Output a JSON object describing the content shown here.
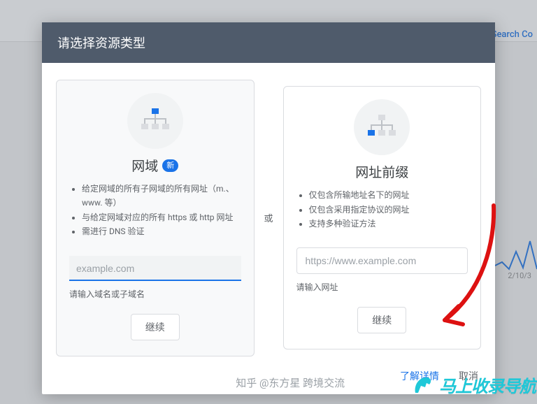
{
  "background": {
    "link_text": "Search Co",
    "chart_date": "2/10/3"
  },
  "modal": {
    "title": "请选择资源类型",
    "or_label": "或",
    "footer": {
      "learn_more": "了解详情",
      "cancel": "取消"
    },
    "domain_card": {
      "title": "网域",
      "new_badge": "新",
      "bullets": [
        "给定网域的所有子网域的所有网址（m.、www. 等）",
        "与给定网域对应的所有 https 或 http 网址",
        "需进行 DNS 验证"
      ],
      "placeholder": "example.com",
      "helper": "请输入域名或子域名",
      "continue_label": "继续"
    },
    "url_card": {
      "title": "网址前缀",
      "bullets": [
        "仅包含所输地址名下的网址",
        "仅包含采用指定协议的网址",
        "支持多种验证方法"
      ],
      "placeholder": "https://www.example.com",
      "helper": "请输入网址",
      "continue_label": "继续"
    }
  },
  "watermark": {
    "zhihu": "知乎 @东方星 跨境交流",
    "brand": "马上收录导航"
  }
}
